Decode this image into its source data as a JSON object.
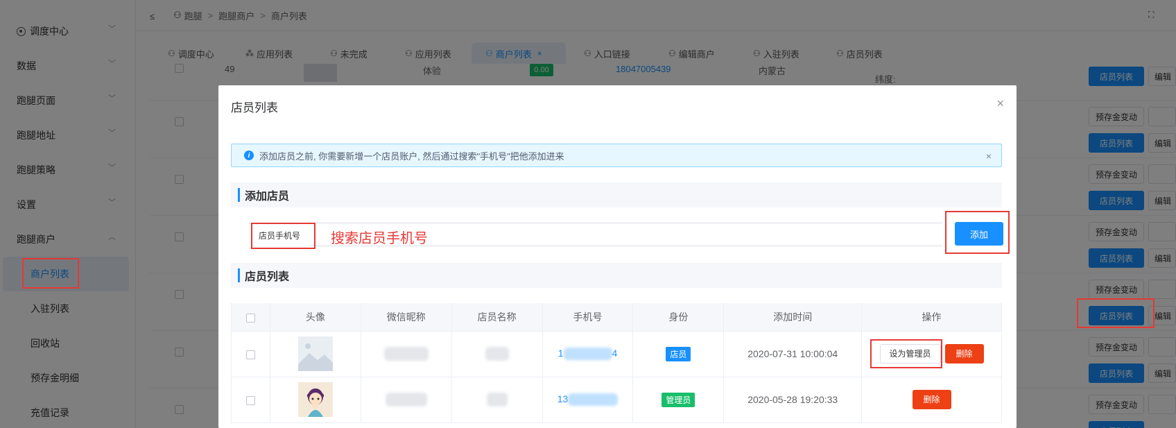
{
  "sidebar": {
    "items": [
      {
        "label": "调度中心",
        "icon": "location-icon",
        "expanded": false
      },
      {
        "label": "数据",
        "expanded": false
      },
      {
        "label": "跑腿页面",
        "expanded": false
      },
      {
        "label": "跑腿地址",
        "expanded": false
      },
      {
        "label": "跑腿策略",
        "expanded": false
      },
      {
        "label": "设置",
        "expanded": false
      },
      {
        "label": "跑腿商户",
        "expanded": true
      }
    ],
    "subitems": [
      {
        "label": "商户列表",
        "active": true
      },
      {
        "label": "入驻列表"
      },
      {
        "label": "回收站"
      },
      {
        "label": "预存金明细"
      },
      {
        "label": "充值记录"
      }
    ]
  },
  "header": {
    "breadcrumb": [
      "跑腿",
      "跑腿商户",
      "商户列表"
    ],
    "sep": ">"
  },
  "tabs": [
    {
      "label": "调度中心"
    },
    {
      "label": "应用列表"
    },
    {
      "label": "未完成"
    },
    {
      "label": "应用列表"
    },
    {
      "label": "商户列表",
      "active": true,
      "close": "×"
    },
    {
      "label": "入口链接"
    },
    {
      "label": "编辑商户"
    },
    {
      "label": "入驻列表"
    },
    {
      "label": "店员列表"
    }
  ],
  "background": {
    "row0": {
      "id": "49",
      "type": "体验",
      "balance": "0.00",
      "phone": "18047005439",
      "region": "内蒙古",
      "coord": "纬度:"
    },
    "btn_prestore": "预存金变动",
    "btn_staff": "店员列表",
    "btn_edit": "编辑"
  },
  "modal": {
    "title": "店员列表",
    "close": "×",
    "alert": "添加店员之前, 你需要新增一个店员账户, 然后通过搜索\"手机号\"把他添加进来",
    "alert_close": "×",
    "add_section": "添加店员",
    "search_label": "店员手机号",
    "search_hint": "搜索店员手机号",
    "add_button": "添加",
    "list_section": "店员列表",
    "columns": [
      "头像",
      "微信昵称",
      "店员名称",
      "手机号",
      "身份",
      "添加时间",
      "操作"
    ],
    "rows": [
      {
        "phone_start": "1",
        "phone_end": "4",
        "role": "店员",
        "added": "2020-07-31 10:00:04",
        "action_set": "设为管理员",
        "action_delete": "删除"
      },
      {
        "phone_start": "13",
        "phone_end": "",
        "role": "管理员",
        "added": "2020-05-28 19:20:33",
        "action_delete": "删除"
      }
    ]
  },
  "colors": {
    "accent": "#1890ff",
    "success": "#19be6b",
    "danger": "#ed4014",
    "annotation": "#e53935"
  }
}
